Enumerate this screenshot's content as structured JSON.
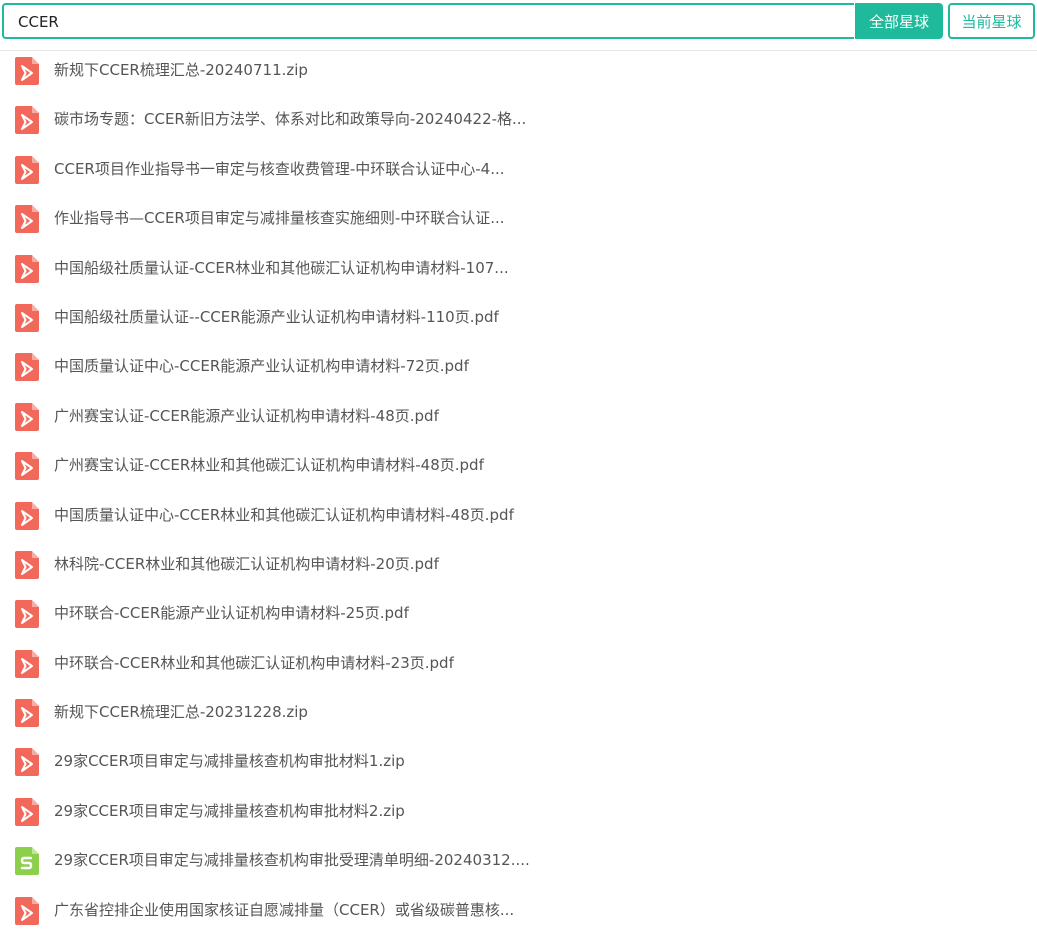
{
  "search": {
    "value": "CCER",
    "all_planets_label": "全部星球",
    "current_planet_label": "当前星球"
  },
  "colors": {
    "accent": "#1fb99b",
    "pdf_icon": "#f2685a",
    "sheet_icon": "#8ccf4d"
  },
  "files": [
    {
      "name": "新规下CCER梳理汇总-20240711.zip",
      "icon": "pdf-icon"
    },
    {
      "name": "碳市场专题：CCER新旧方法学、体系对比和政策导向-20240422-格...",
      "icon": "pdf-icon"
    },
    {
      "name": "CCER项目作业指导书一审定与核查收费管理-中环联合认证中心-4...",
      "icon": "pdf-icon"
    },
    {
      "name": "作业指导书—CCER项目审定与减排量核查实施细则-中环联合认证...",
      "icon": "pdf-icon"
    },
    {
      "name": "中国船级社质量认证-CCER林业和其他碳汇认证机构申请材料-107...",
      "icon": "pdf-icon"
    },
    {
      "name": "中国船级社质量认证--CCER能源产业认证机构申请材料-110页.pdf",
      "icon": "pdf-icon"
    },
    {
      "name": "中国质量认证中心-CCER能源产业认证机构申请材料-72页.pdf",
      "icon": "pdf-icon"
    },
    {
      "name": "广州赛宝认证-CCER能源产业认证机构申请材料-48页.pdf",
      "icon": "pdf-icon"
    },
    {
      "name": "广州赛宝认证-CCER林业和其他碳汇认证机构申请材料-48页.pdf",
      "icon": "pdf-icon"
    },
    {
      "name": "中国质量认证中心-CCER林业和其他碳汇认证机构申请材料-48页.pdf",
      "icon": "pdf-icon"
    },
    {
      "name": "林科院-CCER林业和其他碳汇认证机构申请材料-20页.pdf",
      "icon": "pdf-icon"
    },
    {
      "name": "中环联合-CCER能源产业认证机构申请材料-25页.pdf",
      "icon": "pdf-icon"
    },
    {
      "name": "中环联合-CCER林业和其他碳汇认证机构申请材料-23页.pdf",
      "icon": "pdf-icon"
    },
    {
      "name": "新规下CCER梳理汇总-20231228.zip",
      "icon": "pdf-icon"
    },
    {
      "name": "29家CCER项目审定与减排量核查机构审批材料1.zip",
      "icon": "pdf-icon"
    },
    {
      "name": "29家CCER项目审定与减排量核查机构审批材料2.zip",
      "icon": "pdf-icon"
    },
    {
      "name": "29家CCER项目审定与减排量核查机构审批受理清单明细-20240312....",
      "icon": "sheet-icon"
    },
    {
      "name": "广东省控排企业使用国家核证自愿减排量（CCER）或省级碳普惠核...",
      "icon": "pdf-icon"
    }
  ]
}
